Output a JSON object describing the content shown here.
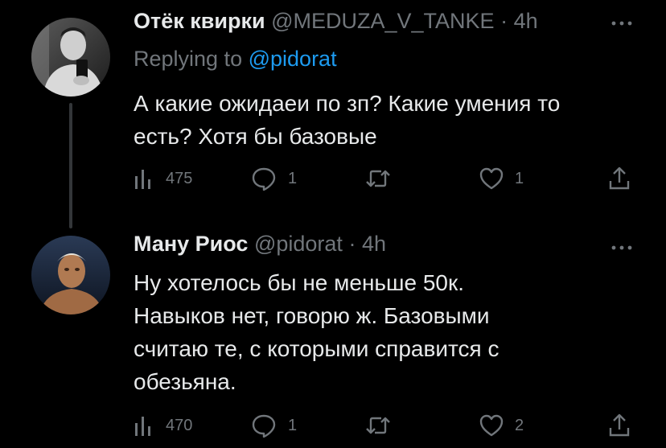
{
  "tweets": [
    {
      "author_name": "Отёк квирки",
      "handle": "@MEDUZA_V_TANKE",
      "separator": "·",
      "time": "4h",
      "replying_prefix": "Replying to",
      "replying_to": "@pidorat",
      "text_lines": [
        "А какие ожидаеи по зп? Какие умения то",
        "есть? Хотя бы базовые"
      ],
      "views": "475",
      "replies": "1",
      "retweets": "",
      "likes": "1"
    },
    {
      "author_name": "Ману Риос",
      "handle": "@pidorat",
      "separator": "·",
      "time": "4h",
      "text_lines": [
        "Ну хотелось бы не меньше 50к.",
        "Навыков нет, говорю ж. Базовыми",
        "считаю те, с которыми справится с",
        "обезьяна."
      ],
      "views": "470",
      "replies": "1",
      "retweets": "",
      "likes": "2"
    }
  ],
  "colors": {
    "background": "#000000",
    "primary_text": "#e7e9ea",
    "secondary_text": "#71767b",
    "link": "#1d9bf0",
    "thread_line": "#333639"
  },
  "icons": [
    "views-icon",
    "reply-icon",
    "retweet-icon",
    "like-icon",
    "share-icon",
    "more-icon"
  ]
}
